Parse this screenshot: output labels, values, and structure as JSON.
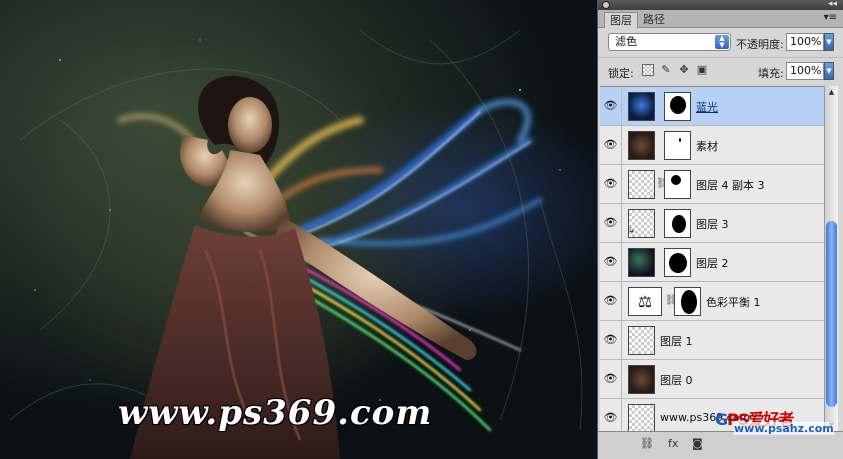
{
  "canvas": {
    "watermark": "www.ps369.com"
  },
  "panel": {
    "tabs": [
      "图层",
      "路径"
    ],
    "blend_mode": "滤色",
    "opacity_label": "不透明度:",
    "opacity_value": "100%",
    "lock_label": "锁定:",
    "fill_label": "填充:",
    "fill_value": "100%",
    "layers": [
      {
        "name": "蓝光",
        "selected": true
      },
      {
        "name": "素材",
        "selected": false
      },
      {
        "name": "图层 4 副本 3",
        "selected": false
      },
      {
        "name": "图层 3",
        "selected": false
      },
      {
        "name": "图层 2",
        "selected": false
      },
      {
        "name": "色彩平衡 1",
        "selected": false
      },
      {
        "name": "图层 1",
        "selected": false
      },
      {
        "name": "图层 0",
        "selected": false
      },
      {
        "name": "www.ps369.com",
        "selected": false
      }
    ],
    "footer_watermark_1": "PS爱好者",
    "footer_watermark_2": "www.psahz.com"
  },
  "colors": {
    "selected_row": "#b7d0f5",
    "scroll_thumb": "#3f78d8",
    "canvas_bg": "#1f2b24"
  }
}
